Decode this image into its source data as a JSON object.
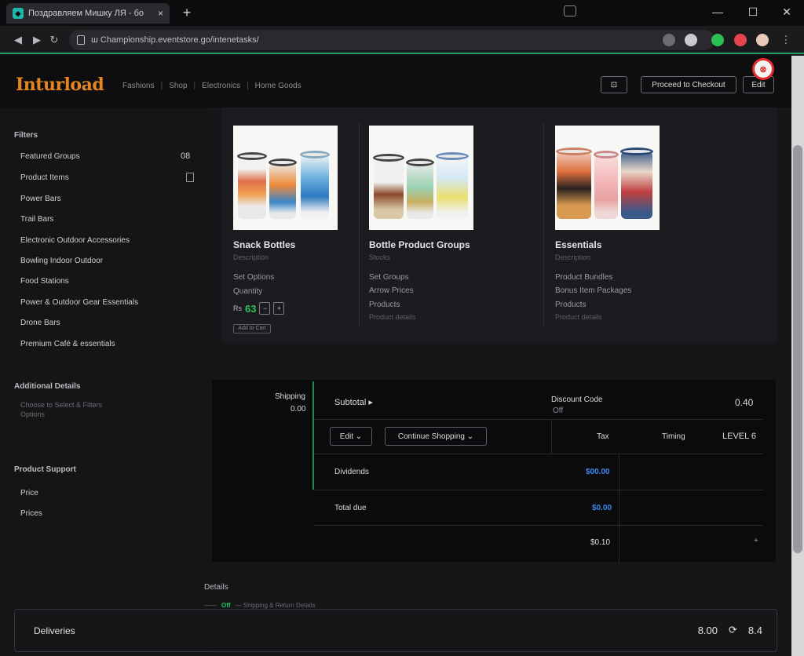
{
  "browser": {
    "tab_title": "Поздравляем Мишку ЛЯ - бо",
    "tab_close": "×",
    "new_tab": "+",
    "url": "ш Сhаmpionship.eventstore.go/intenetasks/",
    "window": {
      "minimize": "—",
      "maximize": "☐",
      "close": "✕"
    }
  },
  "header": {
    "logo": "Inturload",
    "nav": [
      "Fashions",
      "Shop",
      "Electronics",
      "Home Goods"
    ],
    "icon_button": "⊡",
    "primary_button": "Proceed to Checkout",
    "small_button": "Edit",
    "notification": "⊗"
  },
  "sidebar": {
    "section1": "Filters",
    "items": [
      {
        "label": "Featured Groups",
        "count": "08"
      },
      {
        "label": "Product Items",
        "doc": true
      },
      {
        "label": "Power Bars"
      },
      {
        "label": "Trail Bars"
      },
      {
        "label": "Electronic Outdoor Accessories"
      },
      {
        "label": "Bowling Indoor Outdoor"
      },
      {
        "label": "Food Stations"
      },
      {
        "label": "Power & Outdoor Gear Essentials"
      },
      {
        "label": "Drone Bars"
      },
      {
        "label": "Premium Café & essentials"
      }
    ],
    "section2": "Additional Details",
    "section2_sub": [
      "Choose to Select & Filters",
      "Options"
    ],
    "section3": "Product Support",
    "section3_items": [
      "Price",
      "Prices"
    ]
  },
  "products": [
    {
      "name": "Snack Bottles",
      "subtitle": "Description",
      "lines": [
        "Set Options",
        "Quantity"
      ],
      "price_prefix": "Rs",
      "price": "63",
      "qty_minus": "−",
      "qty_plus": "+",
      "tag": "Add to Cart"
    },
    {
      "name": "Bottle Product Groups",
      "subtitle": "Stocks",
      "lines": [
        "Set Groups",
        "Arrow Prices",
        "Products"
      ],
      "dim": "Product details"
    },
    {
      "name": "Essentials",
      "subtitle": "Description",
      "lines": [
        "Product Bundles",
        "Bonus Item Packages",
        "Products"
      ],
      "dim": "Product details"
    }
  ],
  "cart": {
    "left_title": "Shipping",
    "left_value": "0.00",
    "subtotal_label": "Subtotal ▸",
    "discount_label": "Discount Code",
    "discount_sub": "Off",
    "discount_value": "0.40",
    "btn_edit": "Edit ⌄",
    "btn_continue": "Continue Shopping ⌄",
    "col_tax": "Tax",
    "col_timing": "Timing",
    "col_level": "LEVEL 6",
    "row1_label": "Dividends",
    "row1_value": "$00.00",
    "row2_label": "Total due",
    "row2_value": "$0.00",
    "row3_value": "$0.10",
    "row3_arrow": "+"
  },
  "below": {
    "label": "Details",
    "sub_prefix": "——",
    "sub_green": "Off",
    "sub_text": "—  Shipping & Return Details"
  },
  "footer": {
    "label": "Deliveries",
    "value1": "8.00",
    "icon": "⟳",
    "value2": "8.4"
  }
}
